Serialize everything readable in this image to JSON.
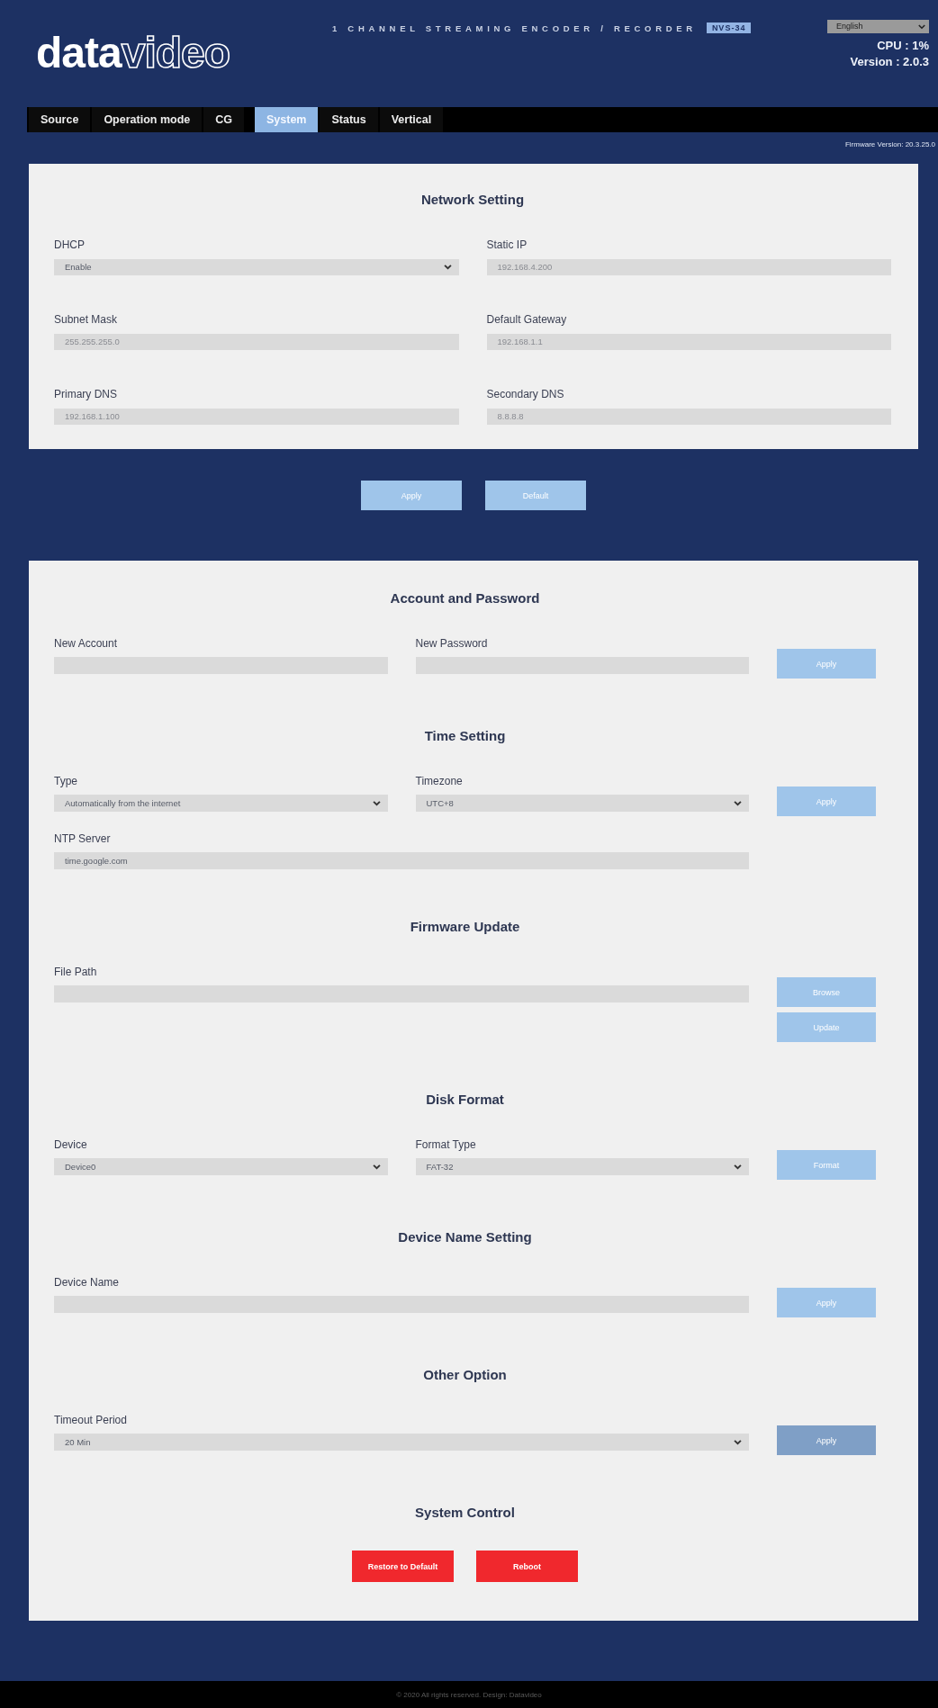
{
  "header": {
    "logo": "**data**video",
    "product_title": "1 CHANNEL STREAMING ENCODER / RECORDER",
    "model_badge": "NVS-34",
    "language_select": {
      "value": "English"
    },
    "cpu": "CPU : 1%",
    "version": "Version : 2.0.3"
  },
  "tabs": [
    {
      "label": "Source",
      "selected": false
    },
    {
      "label": "Operation mode",
      "selected": false
    },
    {
      "label": "CG",
      "selected": false
    },
    {
      "label": "System",
      "selected": true
    },
    {
      "label": "Status",
      "selected": false
    },
    {
      "label": "Vertical",
      "selected": false
    }
  ],
  "firmware_version": "Firmware Version: 20.3.25.0",
  "network_panel": {
    "title": "Network Setting",
    "fields": [
      {
        "label": "DHCP",
        "kind": "select",
        "value": "Enable"
      },
      {
        "label": "Static IP",
        "kind": "input",
        "placeholder": "192.168.4.200"
      },
      {
        "label": "Subnet Mask",
        "kind": "input",
        "placeholder": "255.255.255.0"
      },
      {
        "label": "Default Gateway",
        "kind": "input",
        "placeholder": "192.168.1.1"
      },
      {
        "label": "Primary DNS",
        "kind": "input",
        "placeholder": "192.168.1.100"
      },
      {
        "label": "Secondary DNS",
        "kind": "input",
        "placeholder": "8.8.8.8"
      }
    ]
  },
  "network_buttons": [
    {
      "label": "Apply",
      "kind": "primary",
      "disabled": true
    },
    {
      "label": "Default",
      "kind": "primary",
      "disabled": true
    }
  ],
  "system_panel": {
    "sections": [
      {
        "title": "Account and Password",
        "rows": [
          {
            "fields": [
              {
                "label": "New Account",
                "kind": "input"
              },
              {
                "label": "New Password",
                "kind": "input"
              }
            ],
            "buttons": [
              {
                "label": "Apply",
                "kind": "primary",
                "disabled": true
              }
            ]
          }
        ]
      },
      {
        "title": "Time Setting",
        "rows": [
          {
            "fields": [
              {
                "label": "Type",
                "kind": "select",
                "value": "Automatically from the internet"
              },
              {
                "label": "Timezone",
                "kind": "select",
                "value": "UTC+8"
              }
            ],
            "buttons": [
              {
                "label": "Apply",
                "kind": "primary",
                "disabled": true
              }
            ]
          },
          {
            "fields": [
              {
                "label": "NTP Server",
                "kind": "input",
                "value": "time.google.com"
              }
            ]
          }
        ]
      },
      {
        "title": "Firmware Update",
        "rows": [
          {
            "fields": [
              {
                "label": "File Path",
                "kind": "input"
              }
            ],
            "buttons": [
              {
                "label": "Browse",
                "kind": "primary",
                "disabled": true
              },
              {
                "label": "Update",
                "kind": "primary",
                "disabled": true
              }
            ]
          }
        ]
      },
      {
        "title": "Disk Format",
        "rows": [
          {
            "fields": [
              {
                "label": "Device",
                "kind": "select",
                "value": "Device0"
              },
              {
                "label": "Format Type",
                "kind": "select",
                "value": "FAT-32"
              }
            ],
            "buttons": [
              {
                "label": "Format",
                "kind": "primary",
                "disabled": true
              }
            ]
          }
        ]
      },
      {
        "title": "Device Name Setting",
        "rows": [
          {
            "fields": [
              {
                "label": "Device Name",
                "kind": "input"
              }
            ],
            "buttons": [
              {
                "label": "Apply",
                "kind": "primary",
                "disabled": true
              }
            ]
          }
        ]
      },
      {
        "title": "Other Option",
        "rows": [
          {
            "fields": [
              {
                "label": "Timeout Period",
                "kind": "select",
                "value": "20 Min"
              }
            ],
            "buttons": [
              {
                "label": "Apply",
                "kind": "primary",
                "disabled": false
              }
            ]
          }
        ]
      },
      {
        "title": "System Control",
        "actions": [
          {
            "label": "Restore to Default",
            "kind": "danger"
          },
          {
            "label": "Reboot",
            "kind": "danger"
          }
        ]
      }
    ]
  },
  "footer": "© 2020 All rights reserved. Design: Datavideo"
}
